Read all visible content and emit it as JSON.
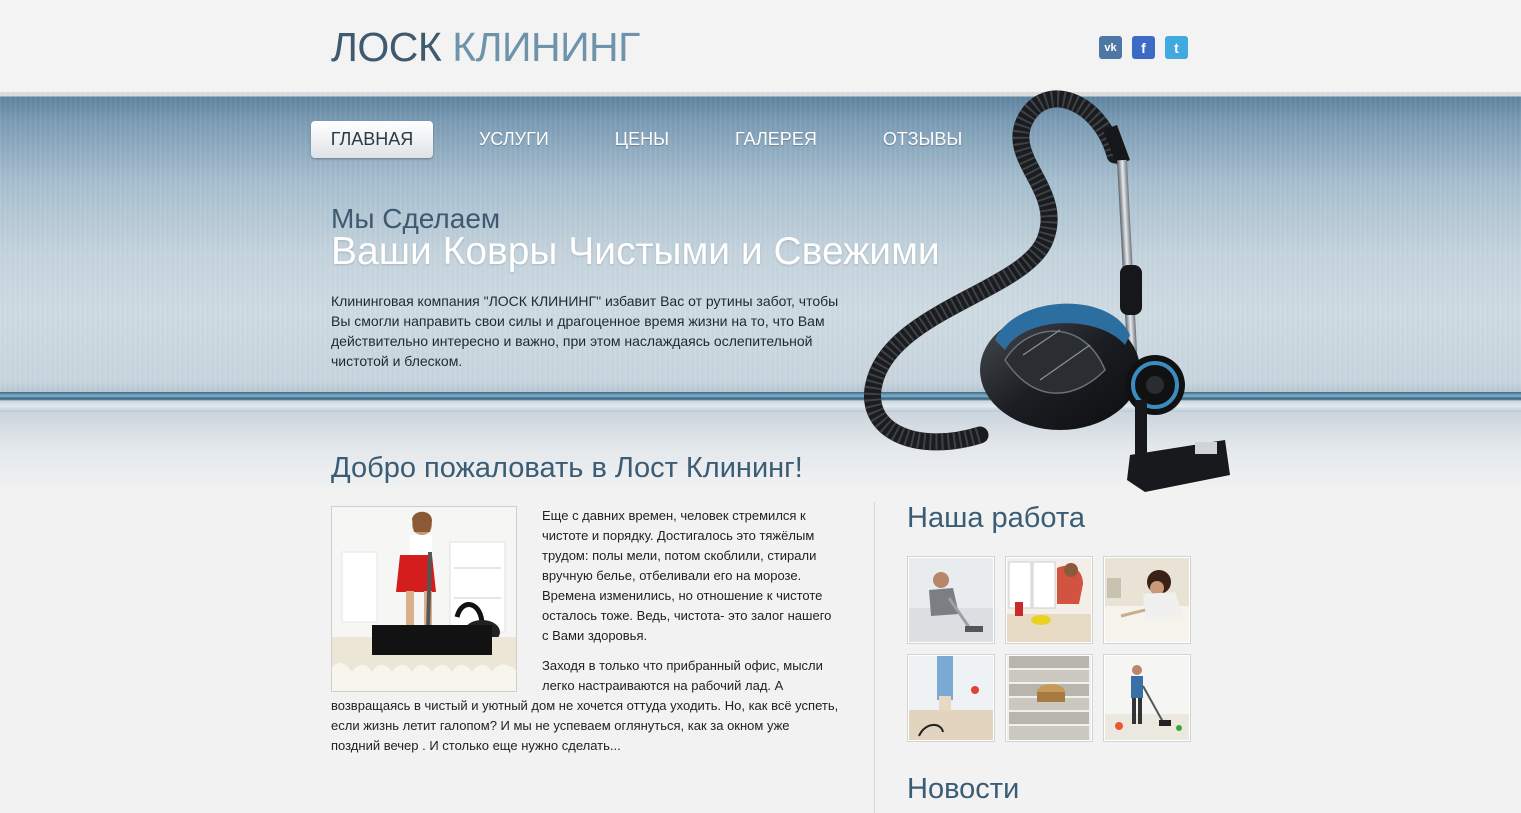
{
  "header": {
    "logo_part1": "ЛОСК",
    "logo_part2": "КЛИНИНГ",
    "social": [
      {
        "name": "vk-icon",
        "glyph": "vk"
      },
      {
        "name": "facebook-icon",
        "glyph": "f"
      },
      {
        "name": "twitter-icon",
        "glyph": "t"
      }
    ]
  },
  "nav": {
    "items": [
      {
        "label": "ГЛАВНАЯ",
        "active": true
      },
      {
        "label": "УСЛУГИ",
        "active": false
      },
      {
        "label": "ЦЕНЫ",
        "active": false
      },
      {
        "label": "ГАЛЕРЕЯ",
        "active": false
      },
      {
        "label": "ОТЗЫВЫ",
        "active": false
      }
    ]
  },
  "hero": {
    "subtitle": "Мы Сделаем",
    "title": "Ваши Ковры Чистыми и Свежими",
    "text": "Клининговая компания \"ЛОСК КЛИНИНГ\" избавит Вас от рутины забот, чтобы Вы смогли направить свои силы и драгоценное время жизни на то, что Вам действительно интересно и важно, при этом наслаждаясь ослепительной чистотой и блеском."
  },
  "main": {
    "welcome_title": "Добро пожаловать в Лост Клининг!",
    "paragraph1": "Еще с давних времен, человек стремился к чистоте и порядку. Достигалось это тяжёлым трудом: полы мели, потом скоблили, стирали вручную белье, отбеливали его на морозе. Времена изменились, но отношение к чистоте осталось тоже. Ведь, чистота- это залог нашего с Вами здоровья.",
    "paragraph2": "Заходя в только что прибранный офис, мысли легко настраиваются на рабочий лад. А возвращаясь в чистый и уютный дом не хочется оттуда уходить. Но, как всё успеть, если жизнь летит галопом? И мы не успеваем оглянуться, как за окном уже поздний вечер . И столько еще нужно сделать..."
  },
  "sidebar": {
    "work_title": "Наша работа",
    "news_title": "Новости"
  },
  "colors": {
    "accent": "#3a5c74",
    "logo_light": "#6f93ab",
    "banner": "#7b9cb5"
  }
}
